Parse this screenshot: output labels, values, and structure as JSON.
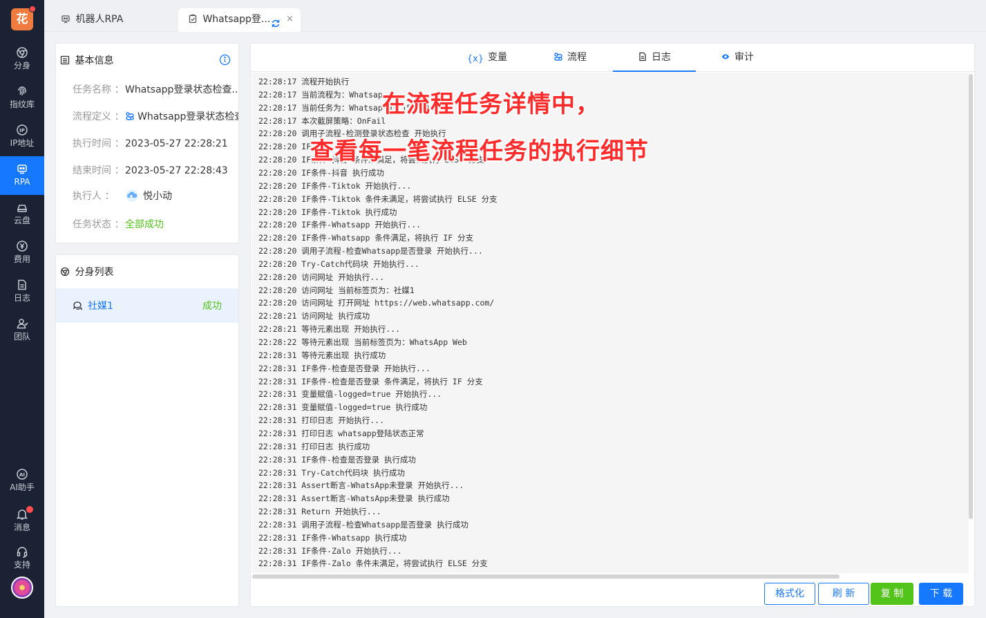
{
  "sidebar": {
    "logo_text": "花",
    "items": [
      {
        "label": "分身",
        "icon": "chrome-icon"
      },
      {
        "label": "指纹库",
        "icon": "fingerprint-icon"
      },
      {
        "label": "IP地址",
        "icon": "ip-icon"
      },
      {
        "label": "RPA",
        "icon": "robot-icon",
        "active": true
      },
      {
        "label": "云盘",
        "icon": "cloud-drive-icon"
      },
      {
        "label": "费用",
        "icon": "yen-icon"
      },
      {
        "label": "日志",
        "icon": "log-icon"
      },
      {
        "label": "团队",
        "icon": "team-icon"
      }
    ],
    "bottom_items": [
      {
        "label": "AI助手",
        "icon": "ai-icon"
      },
      {
        "label": "消息",
        "icon": "bell-icon"
      },
      {
        "label": "支持",
        "icon": "headset-icon"
      }
    ]
  },
  "tabs": [
    {
      "label": "机器人RPA"
    },
    {
      "label": "Whatsapp登...",
      "close": "×"
    }
  ],
  "info": {
    "title": "基本信息",
    "fields": [
      {
        "key": "任务名称",
        "sep": "：",
        "value": "Whatsapp登录状态检查..."
      },
      {
        "key": "流程定义",
        "sep": "：",
        "value": "Whatsapp登录状态检查"
      },
      {
        "key": "执行时间",
        "sep": "：",
        "value": "2023-05-27 22:28:21"
      },
      {
        "key": "结束时间",
        "sep": "：",
        "value": "2023-05-27 22:28:43"
      },
      {
        "key": "执行人",
        "sep": "：",
        "value": "悦小动"
      },
      {
        "key": "任务状态",
        "sep": "：",
        "value": "全部成功"
      }
    ]
  },
  "clones": {
    "title": "分身列表",
    "items": [
      {
        "name": "社媒1",
        "status": "成功"
      }
    ]
  },
  "main_tabs": [
    {
      "label": "变量",
      "icon": "{x}"
    },
    {
      "label": "流程"
    },
    {
      "label": "日志",
      "active": true
    },
    {
      "label": "审计"
    }
  ],
  "log_lines": [
    "22:28:17 流程开始执行",
    "22:28:17 当前流程为：Whatsap",
    "22:28:17 当前任务为：Whatsap                            93 15936)",
    "22:28:17 本次截屏策略：OnFail",
    "22:28:20 调用子流程-检测登录状态检查 开始执行",
    "22:28:20 IF条",
    "22:28:20 IF条件-抖音 条件未满足，将尝试执行 ELSE 分支",
    "22:28:20 IF条件-抖音 执行成功",
    "22:28:20 IF条件-Tiktok 开始执行...",
    "22:28:20 IF条件-Tiktok 条件未满足，将尝试执行 ELSE 分支",
    "22:28:20 IF条件-Tiktok 执行成功",
    "22:28:20 IF条件-Whatsapp 开始执行...",
    "22:28:20 IF条件-Whatsapp 条件满足，将执行 IF 分支",
    "22:28:20 调用子流程-检查Whatsapp是否登录 开始执行...",
    "22:28:20 Try-Catch代码块 开始执行...",
    "22:28:20 访问网址 开始执行...",
    "22:28:20 访问网址 当前标签页为：社媒1",
    "22:28:20 访问网址 打开网址 https://web.whatsapp.com/",
    "22:28:21 访问网址 执行成功",
    "22:28:21 等待元素出现 开始执行...",
    "22:28:22 等待元素出现 当前标签页为：WhatsApp Web",
    "22:28:31 等待元素出现 执行成功",
    "22:28:31 IF条件-检查是否登录 开始执行...",
    "22:28:31 IF条件-检查是否登录 条件满足，将执行 IF 分支",
    "22:28:31 变量赋值-logged=true 开始执行...",
    "22:28:31 变量赋值-logged=true 执行成功",
    "22:28:31 打印日志 开始执行...",
    "22:28:31 打印日志 whatsapp登陆状态正常",
    "22:28:31 打印日志 执行成功",
    "22:28:31 IF条件-检查是否登录 执行成功",
    "22:28:31 Try-Catch代码块 执行成功",
    "22:28:31 Assert断言-WhatsApp未登录 开始执行...",
    "22:28:31 Assert断言-WhatsApp未登录 执行成功",
    "22:28:31 Return 开始执行...",
    "22:28:31 调用子流程-检查Whatsapp是否登录 执行成功",
    "22:28:31 IF条件-Whatsapp 执行成功",
    "22:28:31 IF条件-Zalo 开始执行...",
    "22:28:31 IF条件-Zalo 条件未满足，将尝试执行 ELSE 分支"
  ],
  "overlay": {
    "line1": "在流程任务详情中，",
    "line2": "查看每一笔流程任务的执行细节"
  },
  "buttons": {
    "format": "格式化",
    "refresh": "刷 新",
    "copy": "复 制",
    "download": "下 载"
  },
  "colors": {
    "accent": "#1677ff",
    "success": "#52c41a",
    "sidebar_bg": "#1a2233",
    "overlay_text": "#ff2b2b"
  }
}
